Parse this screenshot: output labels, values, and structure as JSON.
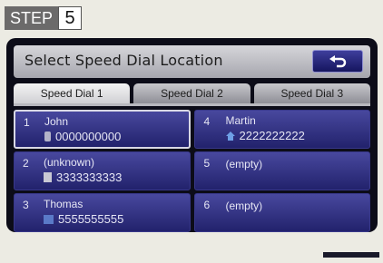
{
  "step": {
    "label": "STEP",
    "number": "5"
  },
  "header": {
    "title": "Select Speed Dial Location"
  },
  "tabs": [
    {
      "label": "Speed Dial 1",
      "active": true
    },
    {
      "label": "Speed Dial 2",
      "active": false
    },
    {
      "label": "Speed Dial 3",
      "active": false
    }
  ],
  "entries": [
    {
      "index": "1",
      "name": "John",
      "number": "0000000000",
      "icon": "mobile-phone-icon"
    },
    {
      "index": "2",
      "name": "(unknown)",
      "number": "3333333333",
      "icon": "office-phone-icon"
    },
    {
      "index": "3",
      "name": "Thomas",
      "number": "5555555555",
      "icon": "other-phone-icon"
    },
    {
      "index": "4",
      "name": "Martin",
      "number": "2222222222",
      "icon": "home-phone-icon"
    },
    {
      "index": "5",
      "name": "(empty)"
    },
    {
      "index": "6",
      "name": "(empty)"
    }
  ]
}
